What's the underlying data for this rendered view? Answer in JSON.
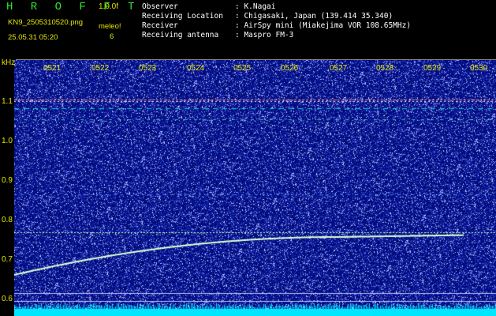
{
  "header": {
    "app_title": "H R O F F T",
    "version": "1.0.0f",
    "filename": "KN9_2505310520.png",
    "meleo_label": "meleo!",
    "meleo_value": "6",
    "timestamp": "25.05.31 05:20"
  },
  "meta": [
    {
      "key": "Observer",
      "value": ": K.Nagai"
    },
    {
      "key": "Receiving Location",
      "value": ": Chigasaki, Japan (139.414 35.340)"
    },
    {
      "key": "Receiver",
      "value": ": AirSpy mini (Miakejima VOR 108.65MHz)"
    },
    {
      "key": "Receiving antenna",
      "value": ": Maspro FM-3"
    }
  ],
  "axis": {
    "unit": "kHz",
    "time_labels": [
      "0521",
      "0522",
      "0523",
      "0524",
      "0525",
      "0526",
      "0527",
      "0528",
      "0529",
      "0530"
    ],
    "freq_labels": [
      "1.1",
      "1.0",
      "0.9",
      "0.8",
      "0.7",
      "0.6"
    ]
  },
  "colors": {
    "background": "#000080",
    "label": "#e6e600",
    "title": "#2ee62e",
    "trace": "#c8ffb4",
    "band": "#00e6ff"
  }
}
